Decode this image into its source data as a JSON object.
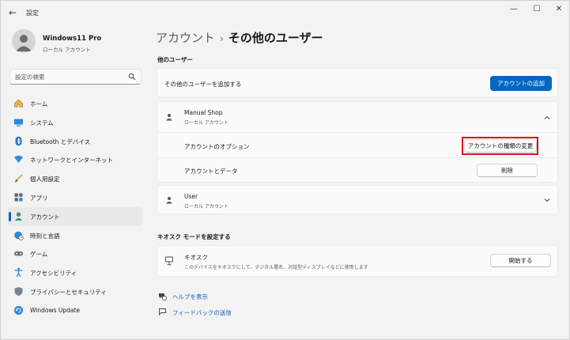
{
  "window": {
    "app_title": "設定",
    "back_glyph": "←",
    "minimize_glyph": "—",
    "maximize_glyph": "☐",
    "close_glyph": "✕"
  },
  "profile": {
    "name": "Windows11 Pro",
    "account_type": "ローカル アカウント"
  },
  "search": {
    "placeholder": "設定の検索"
  },
  "sidebar": {
    "items": [
      {
        "label": "ホーム",
        "icon": "home-icon"
      },
      {
        "label": "システム",
        "icon": "system-icon"
      },
      {
        "label": "Bluetooth とデバイス",
        "icon": "bluetooth-icon"
      },
      {
        "label": "ネットワークとインターネット",
        "icon": "network-icon"
      },
      {
        "label": "個人用設定",
        "icon": "brush-icon"
      },
      {
        "label": "アプリ",
        "icon": "apps-icon"
      },
      {
        "label": "アカウント",
        "icon": "account-icon",
        "active": true
      },
      {
        "label": "時刻と言語",
        "icon": "globe-clock-icon"
      },
      {
        "label": "ゲーム",
        "icon": "gamepad-icon"
      },
      {
        "label": "アクセシビリティ",
        "icon": "accessibility-icon"
      },
      {
        "label": "プライバシーとセキュリティ",
        "icon": "shield-icon"
      },
      {
        "label": "Windows Update",
        "icon": "update-icon"
      }
    ]
  },
  "breadcrumb": {
    "parent": "アカウント",
    "separator": "›",
    "current": "その他のユーザー"
  },
  "other_users": {
    "section_title": "他のユーザー",
    "add_user_label": "その他のユーザーを追加する",
    "add_account_button": "アカウントの追加",
    "users": [
      {
        "name": "Manual Shop",
        "type": "ローカル アカウント",
        "expanded": true,
        "options_label": "アカウントのオプション",
        "change_type_button": "アカウントの種類の変更",
        "data_label": "アカウントとデータ",
        "delete_button": "削除"
      },
      {
        "name": "User",
        "type": "ローカル アカウント",
        "expanded": false
      }
    ]
  },
  "kiosk": {
    "section_title": "キオスク モードを設定する",
    "title": "キオスク",
    "description": "このデバイスをキオスクにして、デジタル署名、対話型ディスプレイなどに使用します",
    "start_button": "開始する"
  },
  "links": {
    "help": "ヘルプを表示",
    "feedback": "フィードバックの送信"
  },
  "colors": {
    "accent": "#0067c0",
    "highlight_border": "#d1171a",
    "window_bg": "#f3f3f3",
    "card_bg": "#fbfbfb"
  }
}
